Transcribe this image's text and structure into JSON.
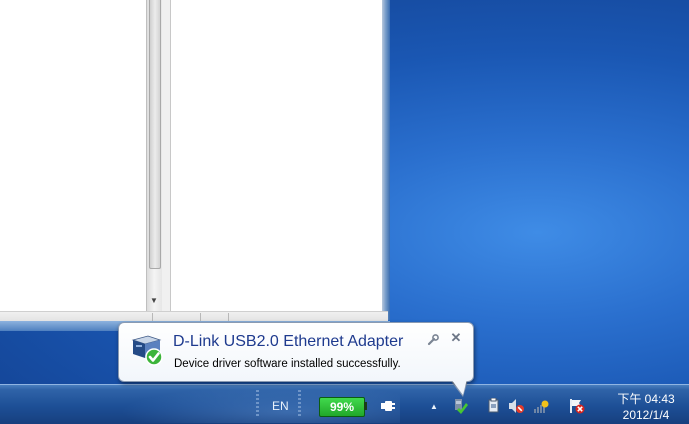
{
  "taskbar": {
    "language": "EN",
    "battery_percent": "99%",
    "clock": {
      "time": "下午 04:43",
      "date": "2012/1/4"
    }
  },
  "notification": {
    "title": "D-Link USB2.0 Ethernet Adapter",
    "message": "Device driver software installed successfully."
  },
  "icons": {
    "notification_icon": "device-install-success-icon",
    "settings": "wrench-icon",
    "close": "close-icon",
    "tray": [
      "show-hidden-icons-arrow",
      "device-install-tray-icon",
      "usb-device-icon",
      "volume-muted-icon",
      "network-icon",
      "action-center-alert-icon"
    ]
  },
  "colors": {
    "notification_title": "#1e3a8e",
    "battery_fill": "#2bbf35",
    "taskbar": "#1d4f96"
  }
}
